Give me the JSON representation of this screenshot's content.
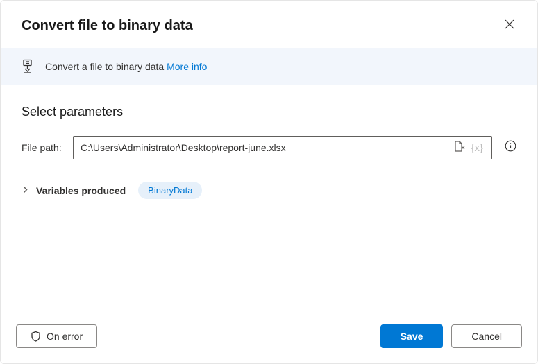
{
  "header": {
    "title": "Convert file to binary data"
  },
  "banner": {
    "text": "Convert a file to binary data ",
    "more_info_label": "More info"
  },
  "params": {
    "section_title": "Select parameters",
    "file_path_label": "File path:",
    "file_path_value": "C:\\Users\\Administrator\\Desktop\\report-june.xlsx"
  },
  "variables": {
    "label": "Variables produced",
    "output_var": "BinaryData"
  },
  "footer": {
    "on_error_label": "On error",
    "save_label": "Save",
    "cancel_label": "Cancel"
  }
}
